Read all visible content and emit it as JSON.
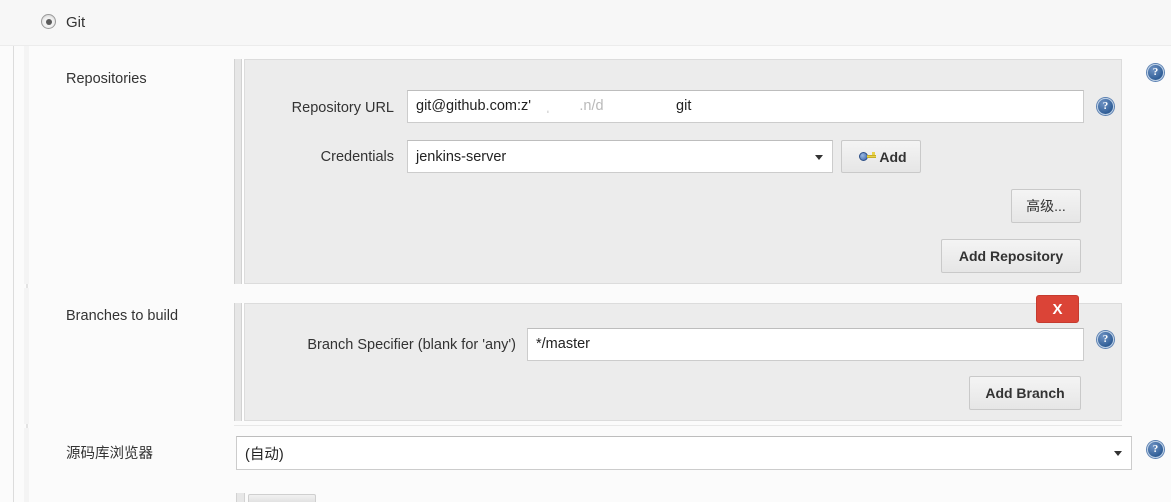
{
  "scm": {
    "radio_label": "Git",
    "radio_selected": true
  },
  "rows": {
    "repositories_label": "Repositories",
    "branches_label": "Branches to build",
    "browser_label": "源码库浏览器"
  },
  "repository": {
    "url_label": "Repository URL",
    "url_value_visible": "git@github.com:z'",
    "url_value_redacted_1": "ˌ",
    "url_value_redacted_2": ".n/d",
    "url_value_tail": "git",
    "credentials_label": "Credentials",
    "credentials_value": "jenkins-server",
    "add_credentials_label": "Add",
    "add_credentials_icon": "key-icon",
    "advanced_label": "高级...",
    "add_repository_label": "Add Repository"
  },
  "branches": {
    "delete_label": "X",
    "specifier_label": "Branch Specifier (blank for 'any')",
    "specifier_value": "*/master",
    "add_branch_label": "Add Branch"
  },
  "browser": {
    "selected_value": "(自动)"
  },
  "help": {
    "glyph": "?",
    "repo_url_help": "?",
    "branch_help": "?",
    "repositories_section_help": "?",
    "browser_help": "?"
  },
  "colors": {
    "page_bg": "#fbfbfb",
    "panel_bg": "#ececec",
    "panel_border": "#dcdcdc",
    "chunk_bar": "#e6e6e6",
    "delete_red": "#db4437",
    "help_blue": "#2f5d96",
    "text": "#333333",
    "input_bg": "#ffffff"
  }
}
